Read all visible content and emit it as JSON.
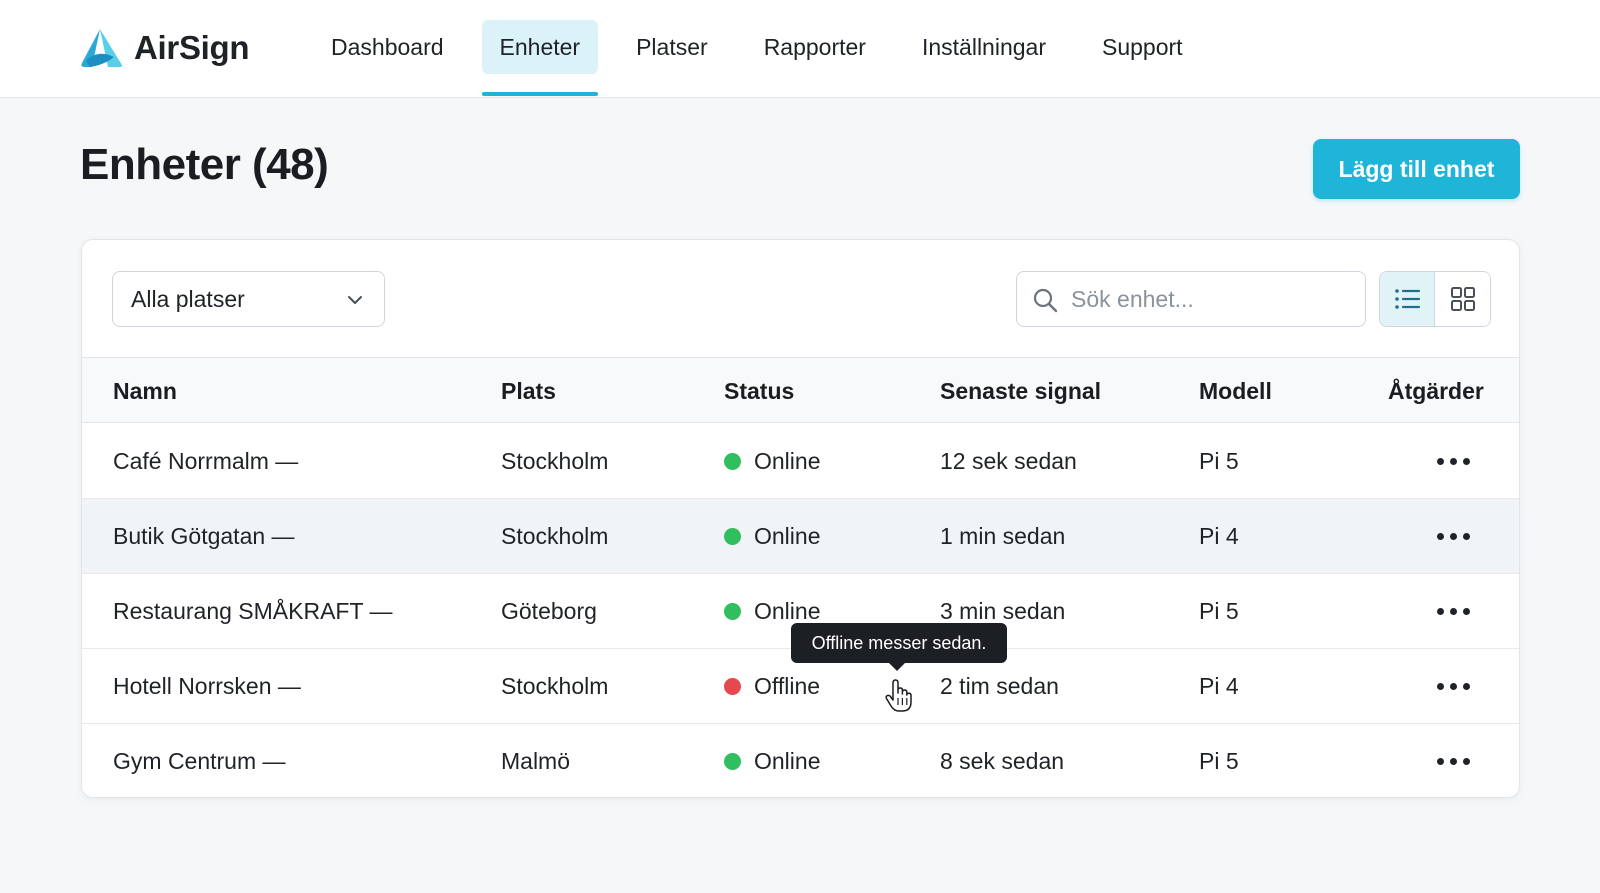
{
  "app": {
    "name": "AirSign",
    "brand_color": "#1fb5d9",
    "logo_icon": "airsign-logo"
  },
  "nav": {
    "items": [
      {
        "label": "Dashboard",
        "active": false
      },
      {
        "label": "Enheter",
        "active": true
      },
      {
        "label": "Platser",
        "active": false
      },
      {
        "label": "Rapporter",
        "active": false
      },
      {
        "label": "Inställningar",
        "active": false
      },
      {
        "label": "Support",
        "active": false
      }
    ]
  },
  "page": {
    "title": "Enheter (48)",
    "add_button_label": "Lägg till enhet"
  },
  "filters": {
    "location_select_value": "Alla platser",
    "search_placeholder": "Sök enhet...",
    "view_modes": [
      {
        "icon": "list-view-icon",
        "active": true
      },
      {
        "icon": "grid-view-icon",
        "active": false
      }
    ]
  },
  "table": {
    "columns": [
      "Namn",
      "Plats",
      "Status",
      "Senaste signal",
      "Modell",
      "Åtgärder"
    ],
    "rows": [
      {
        "name": "Café Norrmalm —",
        "place": "Stockholm",
        "status": "Online",
        "status_color": "#2fbf5f",
        "signal": "12 sek sedan",
        "model": "Pi 5"
      },
      {
        "name": "Butik Götgatan —",
        "place": "Stockholm",
        "status": "Online",
        "status_color": "#2fbf5f",
        "signal": "1 min sedan",
        "model": "Pi 4"
      },
      {
        "name": "Restaurang SMÅKRAFT —",
        "place": "Göteborg",
        "status": "Online",
        "status_color": "#2fbf5f",
        "signal": "3 min sedan",
        "model": "Pi 5"
      },
      {
        "name": "Hotell Norrsken —",
        "place": "Stockholm",
        "status": "Offline",
        "status_color": "#e5484d",
        "signal": "2 tim sedan",
        "model": "Pi 4"
      },
      {
        "name": "Gym Centrum —",
        "place": "Malmö",
        "status": "Online",
        "status_color": "#2fbf5f",
        "signal": "8 sek sedan",
        "model": "Pi 5"
      }
    ]
  },
  "tooltip": {
    "text": "Offline messer sedan."
  }
}
